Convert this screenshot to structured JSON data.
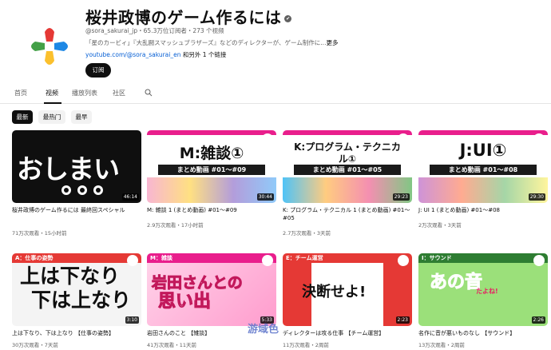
{
  "channel": {
    "name": "桜井政博のゲーム作るには",
    "verified_mark": "✔",
    "meta": "@sora_sakurai_jp・65.3万位订阅者・273 个视频",
    "description": "「星のカービィ」『大乱闘スマッシュブラザーズ』などのディレクターが、ゲーム制作に...",
    "description_more": "更多",
    "link": "youtube.com/@sora_sakurai_en",
    "link_extra": "和另外 1 个链接",
    "subscribe_label": "订阅"
  },
  "tabs": [
    {
      "label": "首页"
    },
    {
      "label": "视频"
    },
    {
      "label": "播放列表"
    },
    {
      "label": "社区"
    }
  ],
  "active_tab": "视频",
  "chips": [
    {
      "label": "最新"
    },
    {
      "label": "最热门"
    },
    {
      "label": "最早"
    }
  ],
  "videos": [
    {
      "title": "桜井政博のゲーム作るには 最終回スペシャル",
      "views": "71万次观看・15小时前",
      "duration": "46:14",
      "thumb_text": "おしまい"
    },
    {
      "title": "M: 雑談 1 (まとめ動画) #01～#09",
      "views": "2.9万次观看・17小时前",
      "duration": "30:44",
      "thumb_text": "M:雑談①",
      "thumb_sub": "まとめ動画 #01～#09"
    },
    {
      "title": "K: プログラム・テクニカル 1 (まとめ動画) #01～#05",
      "views": "2.7万次观看・3天前",
      "duration": "29:23",
      "thumb_text": "K:プログラム・テクニカル①",
      "thumb_sub": "まとめ動画 #01～#05"
    },
    {
      "title": "J: UI 1 (まとめ動画) #01～#08",
      "views": "2万次观看・3天前",
      "duration": "29:30",
      "thumb_text": "J:UI①",
      "thumb_sub": "まとめ動画 #01～#08"
    },
    {
      "title": "上は下なり、下は上なり 【仕事の姿勢】",
      "views": "30万次观看・7天前",
      "duration": "3:10",
      "category": "A：仕事の姿勢",
      "thumb_text_1": "上は下なり",
      "thumb_text_2": "下は上なり"
    },
    {
      "title": "岩田さんのこと 【雑談】",
      "views": "41万次观看・11天前",
      "duration": "5:33",
      "category": "M：雑談",
      "thumb_text_1": "岩田さんとの",
      "thumb_text_2": "思い出"
    },
    {
      "title": "ディレクターは攻る仕事 【チーム運営】",
      "views": "11万次观看・2周前",
      "duration": "2:23",
      "category": "E：チーム運営",
      "thumb_text": "決断せよ!"
    },
    {
      "title": "名作に音が悪いものなし 【サウンド】",
      "views": "13万次观看・2周前",
      "duration": "2:26",
      "category": "I：サウンド",
      "thumb_text": "あの音",
      "thumb_sub": "たよね!"
    }
  ],
  "colors": {
    "accent": "#0f0f0f",
    "link": "#065fd4",
    "pink": "#e91e8c",
    "red": "#e53935",
    "blue": "#1e88e5",
    "green": "#43a047",
    "yellow": "#fbc02d"
  },
  "watermark": "游域色"
}
